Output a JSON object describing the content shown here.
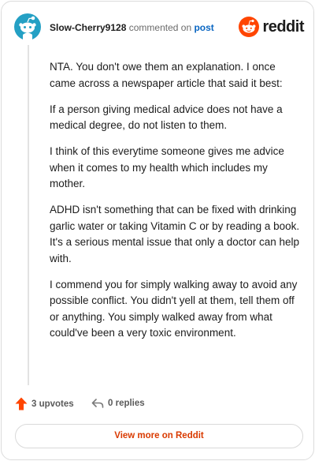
{
  "comment": {
    "username": "Slow-Cherry9128",
    "action_text": "commented on",
    "post_link": "post",
    "paragraphs": [
      "NTA. You don't owe them an explanation. I once came across a newspaper article that said it best:",
      "If a person giving medical advice does not have a medical degree, do not listen to them.",
      "I think of this everytime someone gives me advice when it comes to my health which includes my mother.",
      "ADHD isn't something that can be fixed with drinking garlic water or taking Vitamin C or by reading a book. It's a serious mental issue that only a doctor can help with.",
      "I commend you for simply walking away to avoid any possible conflict. You didn't yell at them, tell them off or anything. You simply walked away from what could've been a very toxic environment."
    ]
  },
  "brand": {
    "name": "reddit",
    "logo_icon": "reddit-snoo-icon",
    "color": "#ff4500"
  },
  "avatar": {
    "icon": "snoo-avatar-icon",
    "color": "#24a0c4"
  },
  "footer": {
    "upvotes_label": "3 upvotes",
    "replies_label": "0 replies",
    "upvote_icon": "upvote-arrow-icon",
    "upvote_color": "#ff4500",
    "reply_icon": "reply-arrow-icon"
  },
  "view_more_label": "View more on Reddit",
  "view_more_color": "#d93a00"
}
